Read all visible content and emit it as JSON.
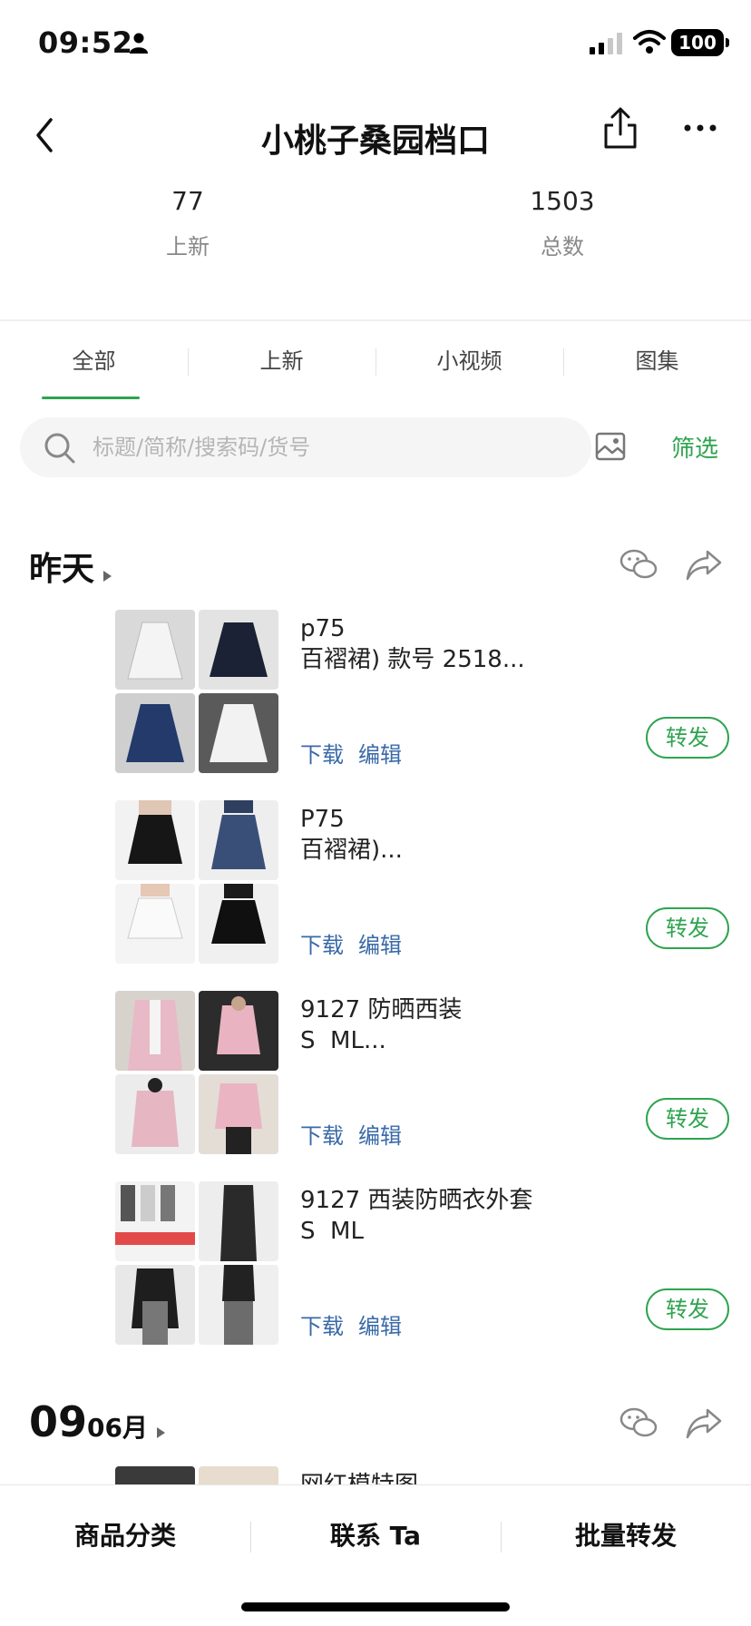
{
  "status": {
    "time": "09:52",
    "battery": "100"
  },
  "header": {
    "title": "小桃子桑园档口"
  },
  "stats": {
    "new_count": "77",
    "new_label": "上新",
    "total_count": "1503",
    "total_label": "总数"
  },
  "tabs": [
    {
      "label": "全部"
    },
    {
      "label": "上新"
    },
    {
      "label": "小视频"
    },
    {
      "label": "图集"
    }
  ],
  "search": {
    "placeholder": "标题/简称/搜索码/货号",
    "filter_label": "筛选"
  },
  "sections": [
    {
      "label": "昨天"
    },
    {
      "day": "09",
      "month": "06月"
    }
  ],
  "actions": {
    "download": "下载",
    "edit": "编辑",
    "forward": "转发"
  },
  "items": [
    {
      "text": "p75\n百褶裙) 款号 2518..."
    },
    {
      "text": "P75\n百褶裙)..."
    },
    {
      "text": "9127 防晒西装\nS  ML..."
    },
    {
      "text": "9127 西装防晒衣外套\nS  ML"
    },
    {
      "text": "网红模特图"
    }
  ],
  "bottom_bar": {
    "category": "商品分类",
    "contact": "联系 Ta",
    "batch_forward": "批量转发"
  }
}
